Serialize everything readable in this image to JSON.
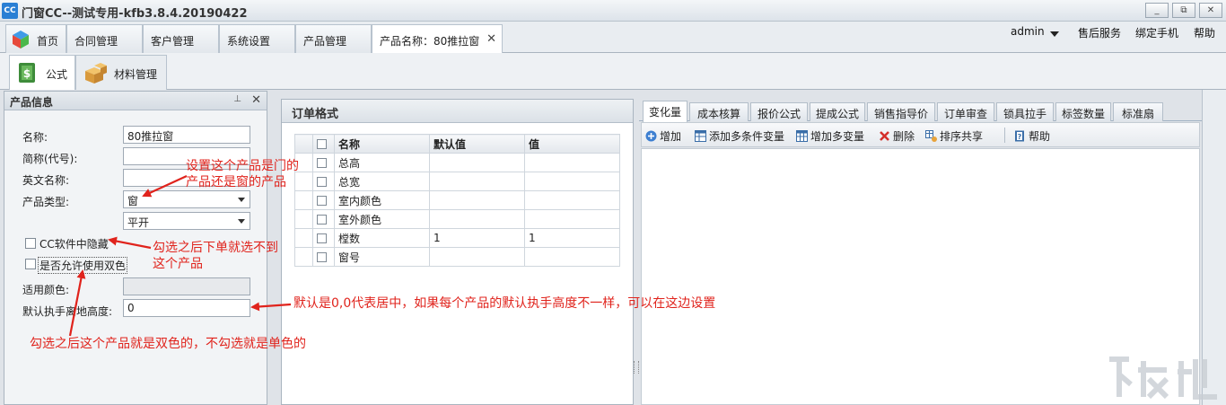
{
  "titlebar": {
    "icon_text": "CC",
    "title": "门窗CC--测试专用-kfb3.8.4.20190422",
    "minimize": "_",
    "restore": "⧉",
    "close": "✕"
  },
  "main_tabs": {
    "home": "首页",
    "contracts": "合同管理",
    "customers": "客户管理",
    "settings": "系统设置",
    "products": "产品管理",
    "product_name": "产品名称：80推拉窗",
    "close_symbol": "✕"
  },
  "top_right": {
    "user": "admin",
    "after_sales": "售后服务",
    "bind_phone": "绑定手机",
    "help": "帮助"
  },
  "sub_tabs": {
    "formula": "公式",
    "materials": "材料管理"
  },
  "product_info": {
    "header": "产品信息",
    "pin": "⊥",
    "close": "✕",
    "name_label": "名称:",
    "name_value": "80推拉窗",
    "short_label": "简称(代号):",
    "short_value": "",
    "english_label": "英文名称:",
    "english_value": "",
    "type_label": "产品类型:",
    "type_value": "窗",
    "subtype_value": "平开",
    "hide_label": "CC软件中隐藏",
    "dual_color_label": "是否允许使用双色",
    "color_label": "适用颜色:",
    "color_value": "",
    "handle_label": "默认执手离地高度:",
    "handle_value": "0"
  },
  "order_format": {
    "header": "订单格式",
    "columns": [
      "名称",
      "默认值",
      "值"
    ],
    "rows": [
      {
        "name": "总高",
        "default": "",
        "value": ""
      },
      {
        "name": "总宽",
        "default": "",
        "value": ""
      },
      {
        "name": "室内颜色",
        "default": "",
        "value": ""
      },
      {
        "name": "室外颜色",
        "default": "",
        "value": ""
      },
      {
        "name": "樘数",
        "default": "1",
        "value": "1"
      },
      {
        "name": "窗号",
        "default": "",
        "value": ""
      }
    ]
  },
  "right_tabs": [
    "变化量",
    "成本核算",
    "报价公式",
    "提成公式",
    "销售指导价",
    "订单审查",
    "锁具拉手",
    "标签数量",
    "标准扇"
  ],
  "toolbar": {
    "add": "增加",
    "add_multi_condition": "添加多条件变量",
    "add_multi_var": "增加多变量",
    "delete": "删除",
    "sort_share": "排序共享",
    "help": "帮助"
  },
  "annotations": {
    "product_type_note": "设置这个产品是门的\n产品还是窗的产品",
    "hide_note": "勾选之后下单就选不到\n这个产品",
    "handle_note": "默认是0,0代表居中，如果每个产品的默认执手高度不一样，可以在这边设置",
    "dual_color_note": "勾选之后这个产品就是双色的，不勾选就是单色的"
  },
  "colors": {
    "annotation": "#e0231c",
    "accent": "#2a7fd4"
  }
}
